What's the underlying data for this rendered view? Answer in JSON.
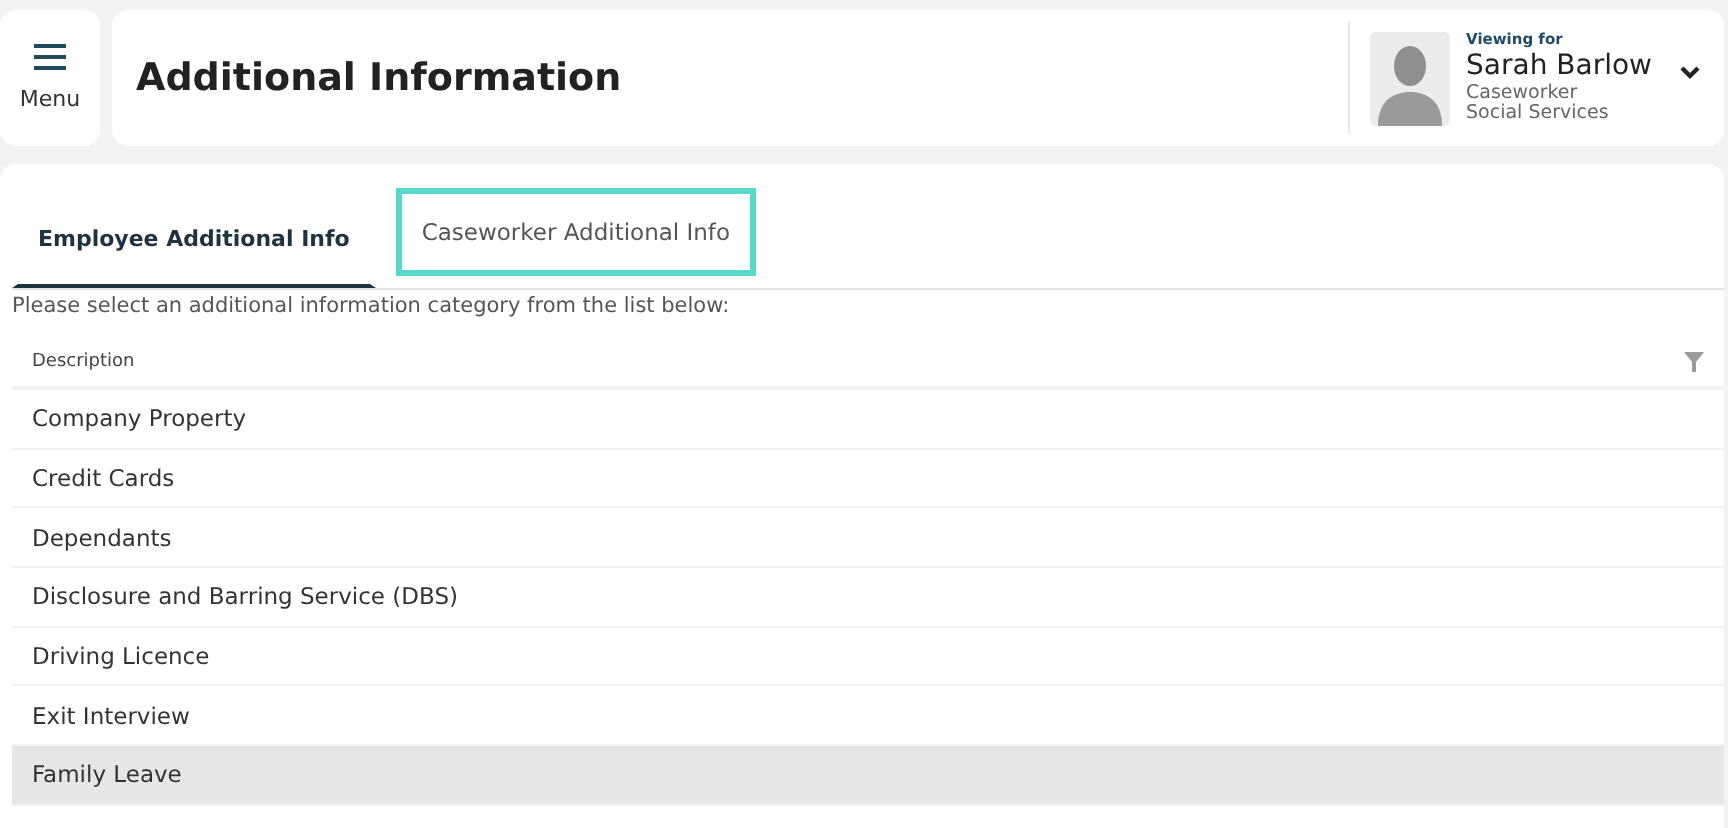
{
  "menu": {
    "label": "Menu"
  },
  "page_title": "Additional Information",
  "user": {
    "viewing_label": "Viewing for",
    "name": "Sarah Barlow",
    "role": "Caseworker",
    "department": "Social Services"
  },
  "tabs": [
    {
      "label": "Employee Additional Info",
      "selected": true,
      "focused": false
    },
    {
      "label": "Caseworker Additional Info",
      "selected": false,
      "focused": true
    }
  ],
  "instructions": "Please select an additional information category from the list below:",
  "table": {
    "columns": [
      "Description"
    ],
    "rows": [
      {
        "description": "Company Property",
        "selected": false
      },
      {
        "description": "Credit Cards",
        "selected": false
      },
      {
        "description": "Dependants",
        "selected": false
      },
      {
        "description": "Disclosure and Barring Service (DBS)",
        "selected": false
      },
      {
        "description": "Driving Licence",
        "selected": false
      },
      {
        "description": "Exit Interview",
        "selected": false
      },
      {
        "description": "Family Leave",
        "selected": true
      }
    ]
  }
}
